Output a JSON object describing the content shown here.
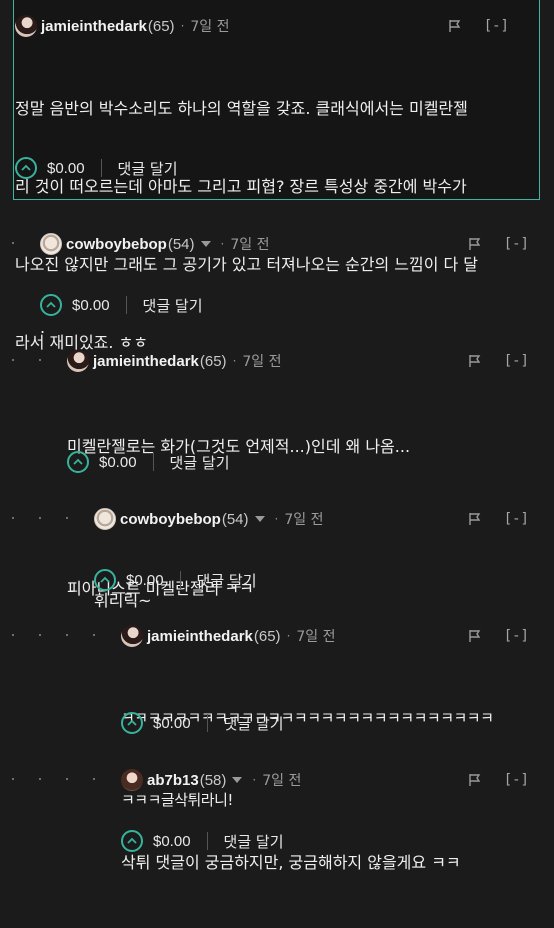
{
  "colors": {
    "background": "#1b1b1b",
    "highlight_border": "#3fb4a6",
    "upvote": "#36b39d",
    "text": "#efefef",
    "muted": "#9b9b9b"
  },
  "icons": {
    "flag": "flag-icon",
    "upvote": "upvote-chevron-icon",
    "dropdown": "caret-down-icon",
    "collapse": "collapse-icon"
  },
  "comments": [
    {
      "username": "jamieinthedark",
      "level": "(65)",
      "separator": "·",
      "time": "7일 전",
      "collapse": "[-]",
      "has_dropdown": false,
      "body": [
        "정말 음반의 박수소리도 하나의 역할을 갖죠. 클래식에서는 미켈란젤",
        "리 것이 떠오르는데 아마도 그리고 피협? 장르 특성상 중간에 박수가",
        "나오진 않지만 그래도 그 공기가 있고 터져나오는 순간의 느낌이 다 달",
        "라서 재미있죠. ㅎㅎ"
      ],
      "amount": "$0.00",
      "reply": "댓글 달기"
    },
    {
      "username": "cowboybebop",
      "level": "(54)",
      "separator": "·",
      "time": "7일 전",
      "collapse": "[-]",
      "has_dropdown": true,
      "body": [
        "."
      ],
      "amount": "$0.00",
      "reply": "댓글 달기"
    },
    {
      "username": "jamieinthedark",
      "level": "(65)",
      "separator": "·",
      "time": "7일 전",
      "collapse": "[-]",
      "has_dropdown": false,
      "body": [
        "미켈란젤로는 화가(그것도 언제적...)인데 왜 나옴...",
        "",
        "피아니스트 미켈란젤리 ㅋㅋ"
      ],
      "amount": "$0.00",
      "reply": "댓글 달기"
    },
    {
      "username": "cowboybebop",
      "level": "(54)",
      "separator": "·",
      "time": "7일 전",
      "collapse": "[-]",
      "has_dropdown": true,
      "body": [
        "휘리릭~"
      ],
      "amount": "$0.00",
      "reply": "댓글 달기"
    },
    {
      "username": "jamieinthedark",
      "level": "(65)",
      "separator": "·",
      "time": "7일 전",
      "collapse": "[-]",
      "has_dropdown": false,
      "body": [
        "ㅋㅋㅋㅋㅋㅋㅋㅋㅋㅋㅋㅋㅋㅋㅋㅋㅋㅋㅋㅋㅋㅋㅋㅋㅋㅋㅋㅋ",
        "ㅋㅋㅋ글삭튀라니!"
      ],
      "amount": "$0.00",
      "reply": "댓글 달기"
    },
    {
      "username": "ab7b13",
      "level": "(58)",
      "separator": "·",
      "time": "7일 전",
      "collapse": "[-]",
      "has_dropdown": true,
      "body": [
        "삭튀 댓글이 궁금하지만, 궁금해하지 않을게요 ㅋㅋ"
      ],
      "amount": "$0.00",
      "reply": "댓글 달기"
    }
  ]
}
